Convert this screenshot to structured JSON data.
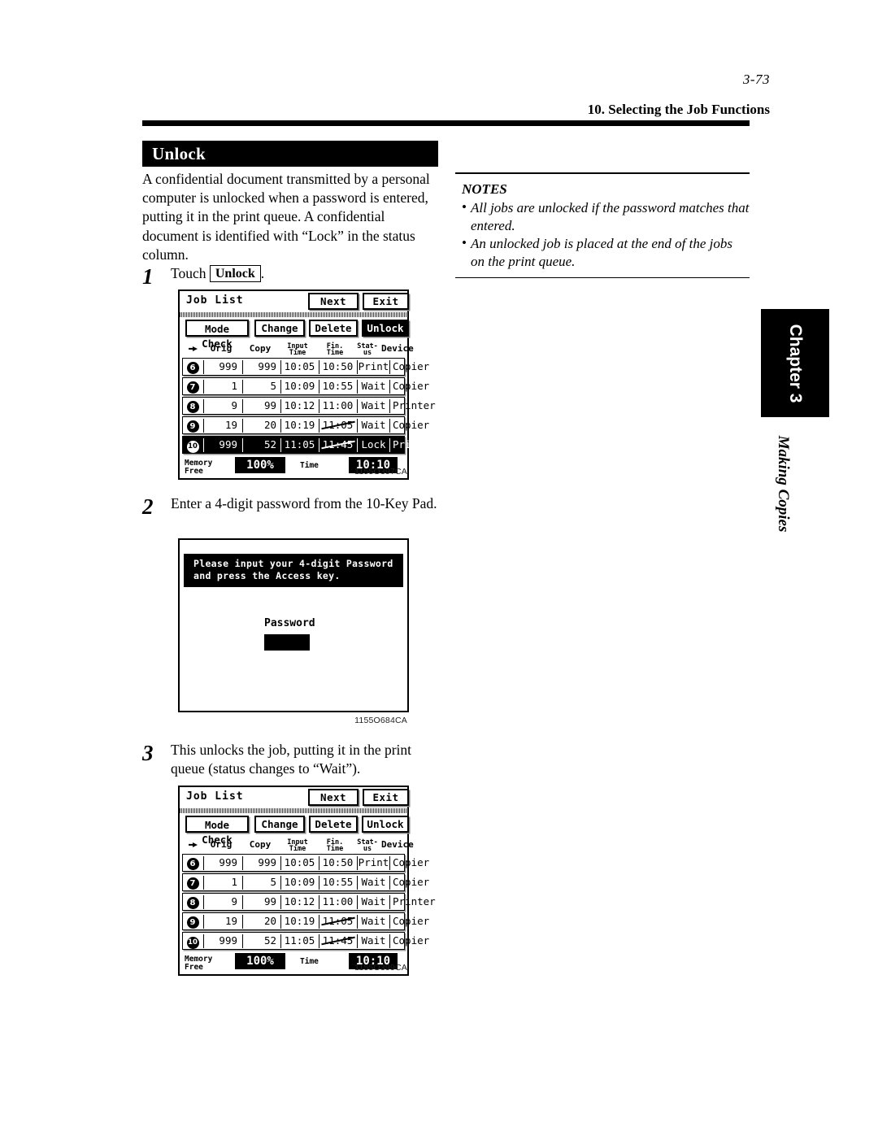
{
  "header": {
    "page_number": "3-73",
    "running_head": "10. Selecting the Job Functions"
  },
  "section": {
    "title": "Unlock"
  },
  "intro": "A confidential document transmitted by a personal computer is unlocked when a password is entered, putting it in the print queue. A confidential document is identified with “Lock” in the status column.",
  "steps": [
    {
      "number": "1",
      "text_before": "Touch",
      "key_label": "Unlock",
      "text_after": "."
    },
    {
      "number": "2",
      "text": "Enter a 4-digit password from the 10-Key Pad."
    },
    {
      "number": "3",
      "text": "This unlocks the job, putting it in the print queue (status changes to “Wait”)."
    }
  ],
  "notes": {
    "title": "NOTES",
    "bullet": "•",
    "items": [
      "All jobs are unlocked if the password matches that entered.",
      "An unlocked job is placed at the end of the jobs on the print queue."
    ]
  },
  "chapter_tab": {
    "label": "Chapter 3",
    "sublabel": "Making Copies"
  },
  "figures": {
    "fig1": {
      "code": "1155O397CA",
      "title": "Job List",
      "buttons": {
        "next": "Next",
        "exit": "Exit",
        "mode_check_line1": "Mode",
        "mode_check_line2": "Check",
        "change": "Change",
        "delete": "Delete",
        "unlock": "Unlock"
      },
      "selected_button": "Unlock",
      "columns": {
        "num": "",
        "orig": "Orig",
        "copy": "Copy",
        "input_time_line1": "Input",
        "input_time_line2": "Time",
        "fin_time_line1": "Fin.",
        "fin_time_line2": "Time",
        "status_line1": "Stat-",
        "status_line2": "us",
        "device": "Device"
      },
      "rows": [
        {
          "no": "6",
          "orig": "999",
          "copy": "999",
          "input": "10:05",
          "fin": "10:50",
          "fin_struck": false,
          "status": "Print",
          "device": "Copier",
          "selected": false
        },
        {
          "no": "7",
          "orig": "1",
          "copy": "5",
          "input": "10:09",
          "fin": "10:55",
          "fin_struck": false,
          "status": "Wait",
          "device": "Copier",
          "selected": false
        },
        {
          "no": "8",
          "orig": "9",
          "copy": "99",
          "input": "10:12",
          "fin": "11:00",
          "fin_struck": false,
          "status": "Wait",
          "device": "Printer",
          "selected": false
        },
        {
          "no": "9",
          "orig": "19",
          "copy": "20",
          "input": "10:19",
          "fin": "11:05",
          "fin_struck": true,
          "status": "Wait",
          "device": "Copier",
          "selected": false
        },
        {
          "no": "10",
          "orig": "999",
          "copy": "52",
          "input": "11:05",
          "fin": "11:45",
          "fin_struck": true,
          "status": "Lock",
          "device": "Printer",
          "selected": true
        }
      ],
      "footer": {
        "memory_free_line1": "Memory",
        "memory_free_line2": "Free",
        "memory_value": "100%",
        "time_label": "Time",
        "time_value": "10:10"
      }
    },
    "fig2": {
      "code": "1155O684CA",
      "banner_line1": "Please input your 4-digit Password",
      "banner_line2": "and press the Access key.",
      "password_label": "Password",
      "password_value": ""
    },
    "fig3": {
      "code": "1155O399CA",
      "title": "Job List",
      "buttons": {
        "next": "Next",
        "exit": "Exit",
        "mode_check_line1": "Mode",
        "mode_check_line2": "Check",
        "change": "Change",
        "delete": "Delete",
        "unlock": "Unlock"
      },
      "selected_button": "",
      "columns": {
        "num": "",
        "orig": "Orig",
        "copy": "Copy",
        "input_time_line1": "Input",
        "input_time_line2": "Time",
        "fin_time_line1": "Fin.",
        "fin_time_line2": "Time",
        "status_line1": "Stat-",
        "status_line2": "us",
        "device": "Device"
      },
      "rows": [
        {
          "no": "6",
          "orig": "999",
          "copy": "999",
          "input": "10:05",
          "fin": "10:50",
          "fin_struck": false,
          "status": "Print",
          "device": "Copier",
          "selected": false
        },
        {
          "no": "7",
          "orig": "1",
          "copy": "5",
          "input": "10:09",
          "fin": "10:55",
          "fin_struck": false,
          "status": "Wait",
          "device": "Copier",
          "selected": false
        },
        {
          "no": "8",
          "orig": "9",
          "copy": "99",
          "input": "10:12",
          "fin": "11:00",
          "fin_struck": false,
          "status": "Wait",
          "device": "Printer",
          "selected": false
        },
        {
          "no": "9",
          "orig": "19",
          "copy": "20",
          "input": "10:19",
          "fin": "11:05",
          "fin_struck": true,
          "status": "Wait",
          "device": "Copier",
          "selected": false
        },
        {
          "no": "10",
          "orig": "999",
          "copy": "52",
          "input": "11:05",
          "fin": "11:45",
          "fin_struck": true,
          "status": "Wait",
          "device": "Copier",
          "selected": false
        }
      ],
      "footer": {
        "memory_free_line1": "Memory",
        "memory_free_line2": "Free",
        "memory_value": "100%",
        "time_label": "Time",
        "time_value": "10:10"
      }
    }
  }
}
